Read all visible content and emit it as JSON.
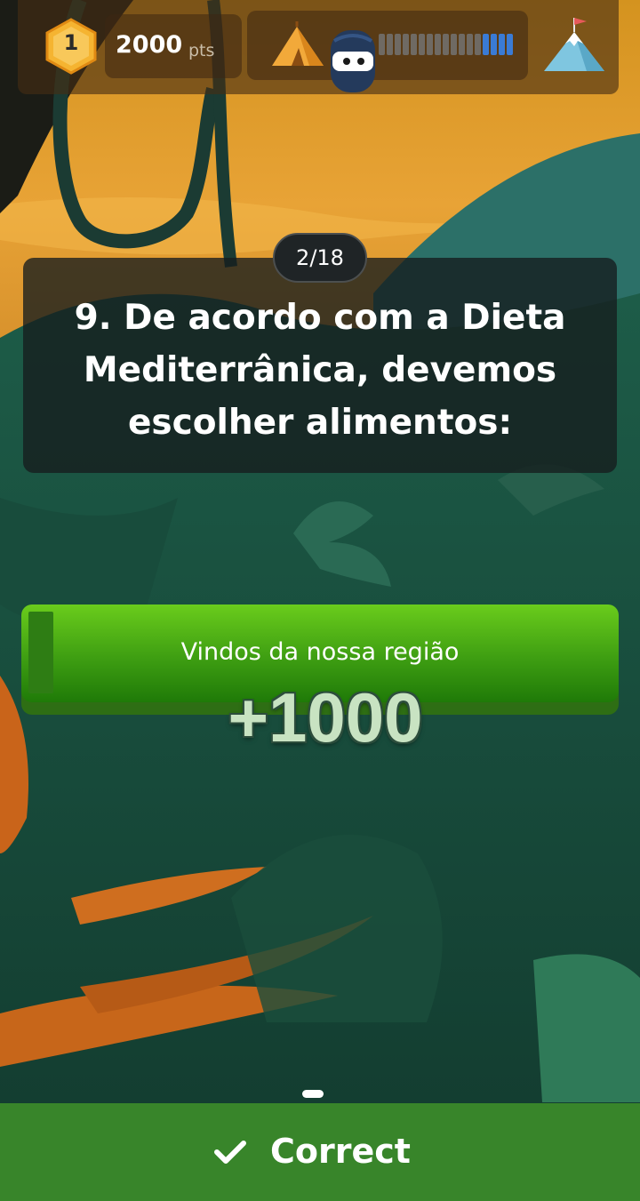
{
  "header": {
    "rank": "1",
    "score_value": "2000",
    "score_unit": "pts",
    "progress": {
      "completed": 4,
      "total": 17
    },
    "start_icon": "tent-icon",
    "avatar_icon": "ninja-avatar-icon",
    "goal_icon": "mountain-flag-icon"
  },
  "question": {
    "counter": "2/18",
    "text": "9. De acordo com a Dieta Mediterrânica, devemos escolher alimentos:"
  },
  "answer": {
    "text": "Vindos da nossa região",
    "points_gained": "+1000",
    "state": "correct"
  },
  "footer": {
    "label": "Correct",
    "icon": "checkmark-icon"
  },
  "colors": {
    "correct_green": "#38852a",
    "answer_green": "#4caf13",
    "progress_blue": "#3a7bd5"
  }
}
